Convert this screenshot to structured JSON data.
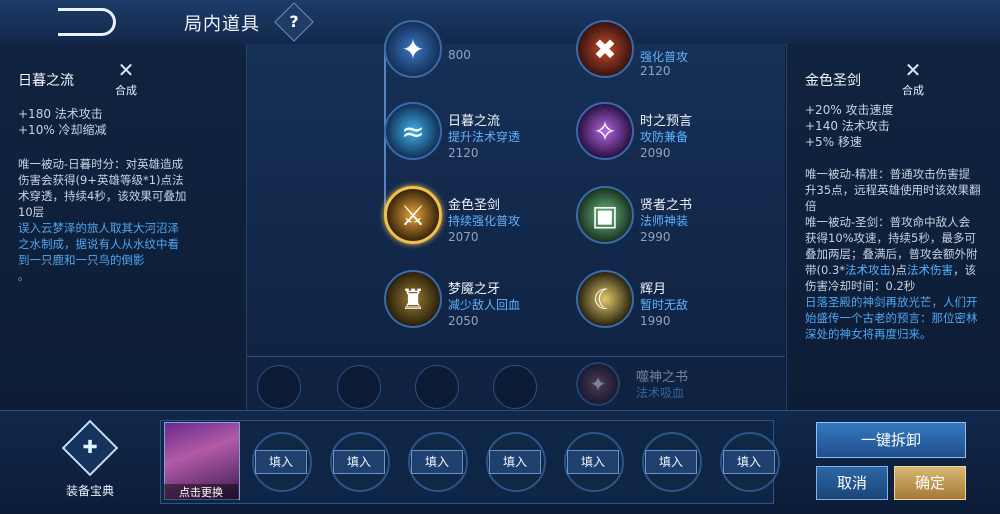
{
  "header": {
    "title": "局内道具",
    "help": "?"
  },
  "left_panel": {
    "name": "日暮之流",
    "craft_label": "合成",
    "stats": [
      "+180 法术攻击",
      "+10% 冷却缩减"
    ],
    "desc": "唯一被动-日暮时分：对英雄造成伤害会获得(9+英雄等级*1)点法术穿透，持续4秒，该效果可叠加10层",
    "lore": "误入云梦泽的旅人取其大河沼泽之水制成，据说有人从水纹中看到一只鹿和一只鸟的倒影",
    "dot": "。"
  },
  "right_panel": {
    "name": "金色圣剑",
    "craft_label": "合成",
    "stats": [
      "+20% 攻击速度",
      "+140 法术攻击",
      "+5% 移速"
    ],
    "desc_a": "唯一被动-精准：普通攻击伤害提升35点，远程英雄使用时该效果翻倍",
    "desc_b": "唯一被动-圣剑：普攻命中敌人会获得10%攻速，持续5秒，最多可叠加两层；叠满后，普攻会额外附带(0.3*",
    "desc_hl1": "法术攻击",
    "desc_c": ")点",
    "desc_hl2": "法术伤害",
    "desc_d": "，该伤害冷却时间：0.2秒",
    "lore": "日落圣殿的神剑再放光芒，人们开始盛传一个古老的预言：那位密林深处的神女将再度归来。"
  },
  "items": [
    {
      "name": "",
      "tag": "",
      "price": "800"
    },
    {
      "name": "",
      "tag": "强化普攻",
      "price": "2120"
    },
    {
      "name": "日暮之流",
      "tag": "提升法术穿透",
      "price": "2120"
    },
    {
      "name": "时之预言",
      "tag": "攻防兼备",
      "price": "2090"
    },
    {
      "name": "金色圣剑",
      "tag": "持续强化普攻",
      "price": "2070"
    },
    {
      "name": "贤者之书",
      "tag": "法师神装",
      "price": "2990"
    },
    {
      "name": "梦魇之牙",
      "tag": "减少敌人回血",
      "price": "2050"
    },
    {
      "name": "辉月",
      "tag": "暂时无敌",
      "price": "1990"
    },
    {
      "name": "噬神之书",
      "tag": "法术吸血",
      "price": ""
    }
  ],
  "bottom": {
    "book_label": "装备宝典",
    "hero_label": "点击更换",
    "fill_label": "填入",
    "disassemble": "一键拆卸",
    "cancel": "取消",
    "confirm": "确定"
  }
}
